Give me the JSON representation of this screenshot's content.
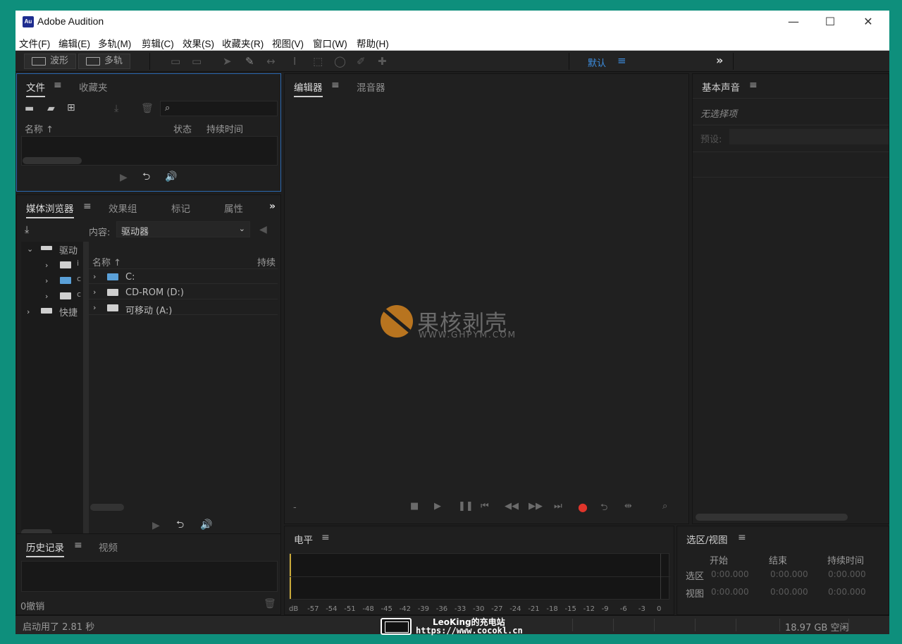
{
  "window": {
    "app_logo": "Au",
    "title": "Adobe Audition",
    "minimize_icon": "—",
    "maximize_icon": "☐",
    "close_icon": "✕"
  },
  "menu": [
    "文件(F)",
    "编辑(E)",
    "多轨(M)",
    "剪辑(C)",
    "效果(S)",
    "收藏夹(R)",
    "视图(V)",
    "窗口(W)",
    "帮助(H)"
  ],
  "toolbar": {
    "waveform_label": "波形",
    "multitrack_label": "多轨",
    "workspace_label": "默认",
    "workspace_menu_icon": "≡",
    "more_icon": "»"
  },
  "files_panel": {
    "tabs": [
      "文件",
      "收藏夹"
    ],
    "menu_icon": "≡",
    "search_icon": "⌕",
    "columns": {
      "name": "名称",
      "status": "状态",
      "duration": "持续时间"
    }
  },
  "media_panel": {
    "tabs": [
      "媒体浏览器",
      "效果组",
      "标记",
      "属性"
    ],
    "menu_icon": "≡",
    "more_icon": "»",
    "content_label": "内容:",
    "content_value": "驱动器",
    "tree": [
      "驱动",
      "快捷"
    ],
    "tree_sub": [
      "i",
      "c",
      "c"
    ],
    "columns": {
      "name": "名称",
      "duration": "持续"
    },
    "rows": [
      "C:",
      "CD-ROM (D:)",
      "可移动 (A:)"
    ]
  },
  "history_panel": {
    "tabs": [
      "历史记录",
      "视频"
    ],
    "menu_icon": "≡",
    "undo_count": "0撤销"
  },
  "editor_panel": {
    "tabs": [
      "编辑器",
      "混音器"
    ],
    "menu_icon": "≡",
    "dash": "-",
    "watermark_title": "果核剥壳",
    "watermark_url": "WWW.GHPYM.COM"
  },
  "levels_panel": {
    "title": "电平",
    "menu_icon": "≡",
    "scale": [
      "dB",
      "-57",
      "-54",
      "-51",
      "-48",
      "-45",
      "-42",
      "-39",
      "-36",
      "-33",
      "-30",
      "-27",
      "-24",
      "-21",
      "-18",
      "-15",
      "-12",
      "-9",
      "-6",
      "-3",
      "0"
    ]
  },
  "essential_sound": {
    "title": "基本声音",
    "menu_icon": "≡",
    "no_selection": "无选择项",
    "preset_label": "预设:"
  },
  "selection_view": {
    "title": "选区/视图",
    "menu_icon": "≡",
    "columns": {
      "start": "开始",
      "end": "结束",
      "duration": "持续时间"
    },
    "rows": [
      {
        "label": "选区",
        "start": "0:00.000",
        "end": "0:00.000",
        "duration": "0:00.000"
      },
      {
        "label": "视图",
        "start": "0:00.000",
        "end": "0:00.000",
        "duration": "0:00.000"
      }
    ]
  },
  "status": {
    "startup": "启动用了 2.81 秒",
    "disk_free": "18.97 GB 空闲"
  },
  "overlay": {
    "line1": "LeoKing的充电站",
    "line2": "https://www.cocokl.cn"
  },
  "colors": {
    "accent": "#3d8ee0",
    "record": "#e0352b",
    "level_marker": "#c9a93a"
  }
}
